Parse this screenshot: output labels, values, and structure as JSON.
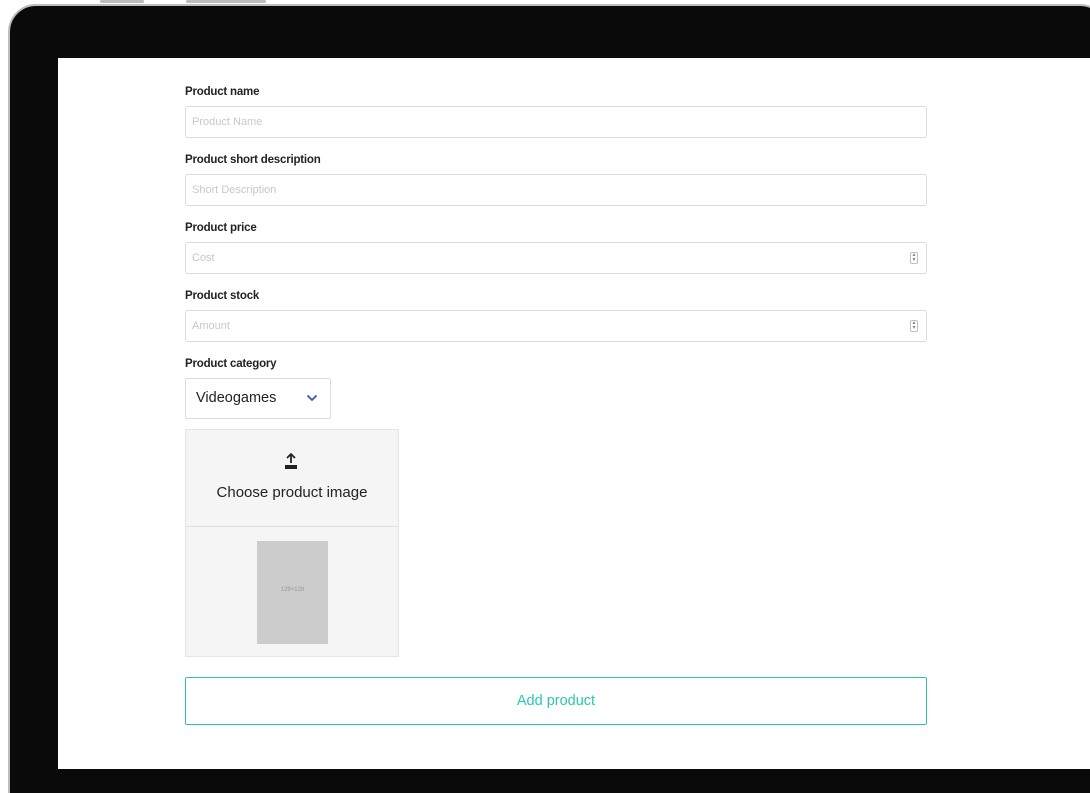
{
  "form": {
    "product_name": {
      "label": "Product name",
      "placeholder": "Product Name"
    },
    "short_description": {
      "label": "Product short description",
      "placeholder": "Short Description"
    },
    "price": {
      "label": "Product price",
      "placeholder": "Cost"
    },
    "stock": {
      "label": "Product stock",
      "placeholder": "Amount"
    },
    "category": {
      "label": "Product category",
      "selected": "Videogames"
    },
    "image": {
      "upload_label": "Choose product image",
      "placeholder_text": "128×128"
    },
    "submit_label": "Add product"
  },
  "colors": {
    "accent": "#2cc5b4",
    "frame": "#0a0a0a",
    "orange": "#f5a623",
    "placeholder_bg": "#cccccc"
  },
  "icons": {
    "upload": "upload-icon",
    "chevron": "chevron-down-icon",
    "spinner": "spinner-icon"
  }
}
